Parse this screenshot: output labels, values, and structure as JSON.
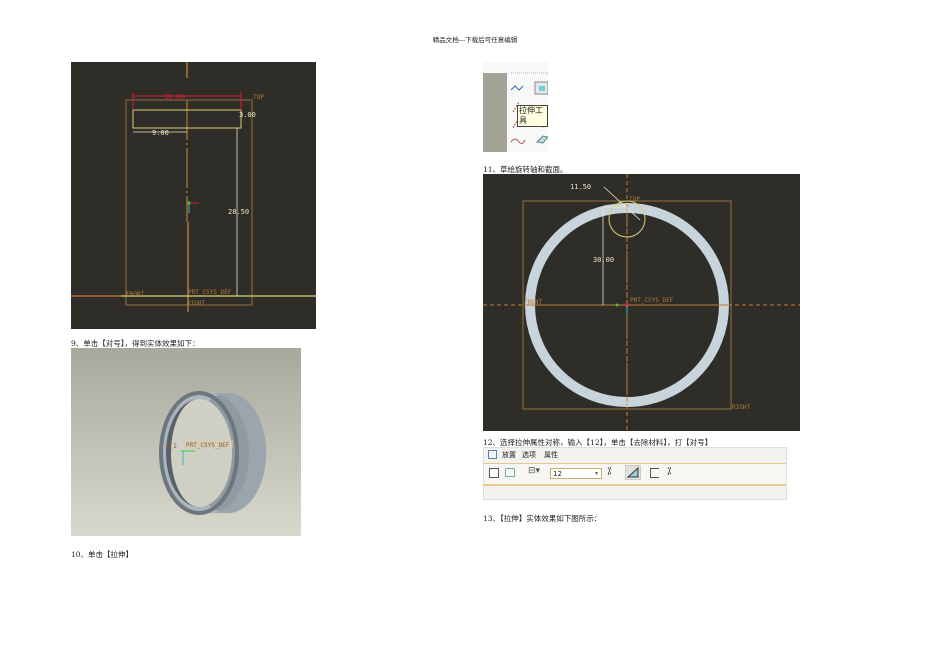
{
  "header": {
    "text": "精品文档---下载后可任意编辑"
  },
  "steps": {
    "s9": "9、单击【对号】，得到实体效果如下：",
    "s10": "10、单击【拉伸】",
    "s11": "11、草绘旋转轴和截面。",
    "s12": "12、选择拉伸属性对称，输入【12】，单击【去除材料】，打【对号】",
    "s13": "13、【拉伸】实体效果如下图所示："
  },
  "sketch1": {
    "dim_width": "18.00",
    "dim_thickness": "3.00",
    "dim_offset": "9.00",
    "dim_height": "28.50",
    "label_top": "TOP",
    "label_front": "FRONT",
    "label_right": "RIGHT",
    "label_csys": "PRT_CSYS_DEF"
  },
  "solid1": {
    "label_axis": "A_2",
    "label_csys": "PRT_CSYS_DEF"
  },
  "tool_palette": {
    "tooltip": "拉伸工具"
  },
  "sketch2": {
    "dim_diameter": "11.50",
    "dim_height": "30.00",
    "label_top": "TOP",
    "label_front": "FRONT",
    "label_right": "RIGHT",
    "label_csys": "PRT_CSYS_DEF"
  },
  "dashboard": {
    "tabs": [
      "放置",
      "选项",
      "属性"
    ],
    "depth_value": "12"
  },
  "colors": {
    "sketch_bg": "#2f2d28",
    "ring": "#c8d4dc",
    "datum": "#b07a3a",
    "dim": "#e8e4c8",
    "constraint": "#d0203a"
  }
}
